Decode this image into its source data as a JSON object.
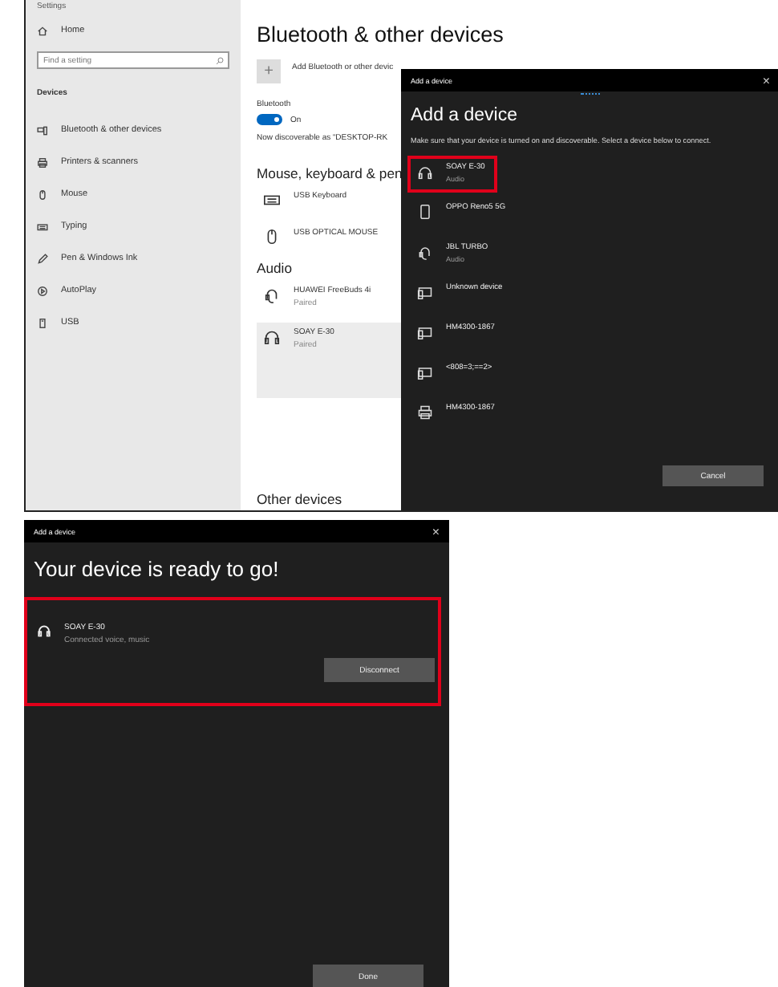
{
  "settings_window": {
    "title": "Settings",
    "sidebar": {
      "home": "Home",
      "search": {
        "placeholder": "Find a setting"
      },
      "section": "Devices",
      "items": [
        {
          "label": "Bluetooth & other devices",
          "kind": "bluetooth"
        },
        {
          "label": "Printers & scanners",
          "kind": "printer"
        },
        {
          "label": "Mouse",
          "kind": "mouse"
        },
        {
          "label": "Typing",
          "kind": "keyboard"
        },
        {
          "label": "Pen & Windows Ink",
          "kind": "pen"
        },
        {
          "label": "AutoPlay",
          "kind": "autoplay"
        },
        {
          "label": "USB",
          "kind": "usb"
        }
      ]
    },
    "main": {
      "title": "Bluetooth & other devices",
      "add_icon": "+",
      "add_button": "Add Bluetooth or other devic",
      "bluetooth_label": "Bluetooth",
      "toggle": {
        "on": true,
        "label": "On"
      },
      "discoverable": "Now discoverable as “DESKTOP-RK",
      "groups": [
        {
          "heading": "Mouse, keyboard & pen",
          "devices": [
            {
              "name": "USB Keyboard",
              "kind": "keyboard",
              "selected": false
            },
            {
              "name": "USB OPTICAL MOUSE",
              "kind": "mouse",
              "selected": false
            }
          ]
        },
        {
          "heading": "Audio",
          "devices": [
            {
              "name": "HUAWEI FreeBuds 4i",
              "status": "Paired",
              "kind": "headset",
              "selected": false
            },
            {
              "name": "SOAY E-30",
              "status": "Paired",
              "kind": "headphones",
              "selected": true
            }
          ]
        }
      ],
      "other_heading": "Other devices"
    }
  },
  "add_device_dialog": {
    "title": "Add a device",
    "close": "×",
    "heading": "Add a device",
    "description": "Make sure that your device is turned on and discoverable. Select a device below to connect.",
    "devices": [
      {
        "name": "SOAY E-30",
        "status": "Audio",
        "kind": "headphones",
        "highlighted": true
      },
      {
        "name": "OPPO Reno5 5G",
        "kind": "phone",
        "highlighted": false
      },
      {
        "name": "JBL TURBO",
        "status": "Audio",
        "kind": "headset",
        "highlighted": false
      },
      {
        "name": "Unknown device",
        "kind": "display",
        "highlighted": false
      },
      {
        "name": "HM4300-1867",
        "kind": "display",
        "highlighted": false
      },
      {
        "name": "<808=3;==2>",
        "kind": "display",
        "highlighted": false
      },
      {
        "name": "HM4300-1867",
        "kind": "printer",
        "highlighted": false
      }
    ],
    "cancel": "Cancel"
  },
  "ready_dialog": {
    "title": "Add a device",
    "close": "×",
    "heading": "Your device is ready to go!",
    "device": {
      "name": "SOAY E-30",
      "status": "Connected voice, music",
      "kind": "headphones",
      "highlighted": true
    },
    "disconnect": "Disconnect",
    "done": "Done"
  }
}
